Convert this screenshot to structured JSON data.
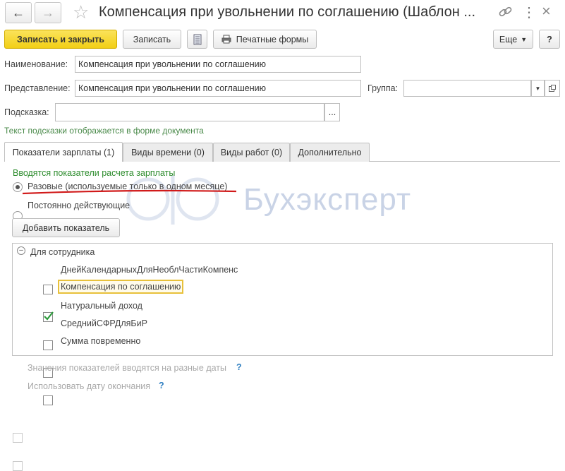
{
  "window": {
    "title": "Компенсация при увольнении по соглашению (Шаблон ..."
  },
  "toolbar": {
    "save_close_label": "Записать и закрыть",
    "save_label": "Записать",
    "print_label": "Печатные формы",
    "more_label": "Еще",
    "help_label": "?"
  },
  "form": {
    "name_label": "Наименование:",
    "name_value": "Компенсация при увольнении по соглашению",
    "repr_label": "Представление:",
    "repr_value": "Компенсация при увольнении по соглашению",
    "group_label": "Группа:",
    "group_value": "",
    "hint_label": "Подсказка:",
    "hint_value": "",
    "hint_note": "Текст подсказки отображается в форме документа",
    "ellipsis": "..."
  },
  "tabs": [
    {
      "label": "Показатели зарплаты (1)",
      "active": true
    },
    {
      "label": "Виды времени (0)",
      "active": false
    },
    {
      "label": "Виды работ (0)",
      "active": false
    },
    {
      "label": "Дополнительно",
      "active": false
    }
  ],
  "indicators": {
    "section_title": "Вводятся показатели расчета зарплаты",
    "radio_one_time": "Разовые (используемые только в одном месяце)",
    "radio_permanent": "Постоянно действующие",
    "add_button": "Добавить показатель",
    "group_title": "Для сотрудника",
    "items": [
      {
        "label": "ДнейКалендарныхДляНеоблЧастиКомпенс",
        "checked": false
      },
      {
        "label": "Компенсация по соглашению",
        "checked": true
      },
      {
        "label": "Натуральный доход",
        "checked": false
      },
      {
        "label": "СреднийСФРДляБиР",
        "checked": false
      },
      {
        "label": "Сумма повременно",
        "checked": false
      }
    ],
    "option_dates": "Значения показателей вводятся на разные даты",
    "option_end_date": "Использовать дату окончания",
    "qmark": "?"
  },
  "watermark": "Бухэксперт",
  "colors": {
    "primary_button": "#f2cf16",
    "section_green": "#2d8c2d",
    "underline_red": "#d11a1a",
    "highlight_border": "#e8c13a"
  }
}
